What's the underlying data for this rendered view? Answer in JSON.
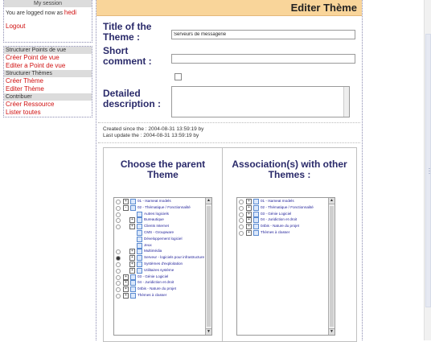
{
  "session": {
    "header": "My session",
    "logged_prefix": "You are logged now as",
    "username": "hedi",
    "logout": "Logout"
  },
  "menu": [
    {
      "type": "section",
      "label": "Structurer Points de vue"
    },
    {
      "type": "link",
      "label": "Créer Point de vue"
    },
    {
      "type": "link",
      "label": "Editer a Point de vue"
    },
    {
      "type": "section",
      "label": "Structurer Thèmes"
    },
    {
      "type": "link",
      "label": "Créer Thème"
    },
    {
      "type": "link",
      "label": "Editer Thème"
    },
    {
      "type": "section",
      "label": "Contribuer"
    },
    {
      "type": "link",
      "label": "Créer Ressource"
    },
    {
      "type": "link",
      "label": "Lister toutes"
    }
  ],
  "page_title": "Editer Thème",
  "form": {
    "title_label_1": "Title of the",
    "title_label_2": "Theme :",
    "title_value": "Serveurs de messagerie",
    "comment_label_1": "Short",
    "comment_label_2": "comment :",
    "comment_value": "",
    "desc_label_1": "Detailed",
    "desc_label_2": "description :",
    "desc_value": ""
  },
  "meta": {
    "created": "Created since the : 2004-08-31 13:59:19 by",
    "updated": "Last update the : 2004-08-31 13:59:19 by"
  },
  "parent_panel": {
    "title_1": "Choose the parent",
    "title_2": "Theme",
    "rows": [
      {
        "label": "01 - Isameat models",
        "indent": 0,
        "radio": true,
        "selected": false,
        "expander": "+"
      },
      {
        "label": "02 - Thématique / Fonctionnalité",
        "indent": 0,
        "radio": true,
        "selected": false,
        "expander": "-"
      },
      {
        "label": "Autres logiciels",
        "indent": 1,
        "radio": true,
        "selected": false,
        "expander": ""
      },
      {
        "label": "Bureautique",
        "indent": 1,
        "radio": true,
        "selected": false,
        "expander": "+"
      },
      {
        "label": "Clients Internet",
        "indent": 1,
        "radio": true,
        "selected": false,
        "expander": "+"
      },
      {
        "label": "CMS - Groupware",
        "indent": 1,
        "radio": false,
        "selected": false,
        "expander": ""
      },
      {
        "label": "Développement logiciel",
        "indent": 1,
        "radio": false,
        "selected": false,
        "expander": ""
      },
      {
        "label": "Jeux",
        "indent": 1,
        "radio": false,
        "selected": false,
        "expander": ""
      },
      {
        "label": "Multimédia",
        "indent": 1,
        "radio": true,
        "selected": false,
        "expander": "+"
      },
      {
        "label": "Serveur - logiciels pour infrastructure",
        "indent": 1,
        "radio": true,
        "selected": true,
        "expander": "+"
      },
      {
        "label": "Systèmes d'exploitation",
        "indent": 1,
        "radio": true,
        "selected": false,
        "expander": "+"
      },
      {
        "label": "Utilitaires système",
        "indent": 1,
        "radio": true,
        "selected": false,
        "expander": "+"
      },
      {
        "label": "03 - Génie Logiciel",
        "indent": 0,
        "radio": true,
        "selected": false,
        "expander": "+"
      },
      {
        "label": "04 - Juridiction et droit",
        "indent": 0,
        "radio": true,
        "selected": false,
        "expander": "+"
      },
      {
        "label": "04bis - Nature du projet",
        "indent": 0,
        "radio": true,
        "selected": false,
        "expander": "+"
      },
      {
        "label": "Thèmes à classer",
        "indent": 0,
        "radio": true,
        "selected": false,
        "expander": "+"
      }
    ]
  },
  "assoc_panel": {
    "title_1": "Association(s) with other",
    "title_2": "Themes :",
    "rows": [
      {
        "label": "01 - Isameat models",
        "indent": 0,
        "radio": true,
        "selected": false,
        "expander": "+"
      },
      {
        "label": "02 - Thématique / Fonctionnalité",
        "indent": 0,
        "radio": true,
        "selected": false,
        "expander": "+"
      },
      {
        "label": "03 - Génie Logiciel",
        "indent": 0,
        "radio": true,
        "selected": false,
        "expander": "+"
      },
      {
        "label": "04 - Juridiction et droit",
        "indent": 0,
        "radio": true,
        "selected": false,
        "expander": "+"
      },
      {
        "label": "04bis - Nature du projet",
        "indent": 0,
        "radio": true,
        "selected": false,
        "expander": "+"
      },
      {
        "label": "Thèmes à classer",
        "indent": 0,
        "radio": true,
        "selected": false,
        "expander": "+"
      }
    ]
  },
  "colors": {
    "title_bar": "#f9d59a",
    "link": "#d01010",
    "label": "#2a2a6a"
  }
}
